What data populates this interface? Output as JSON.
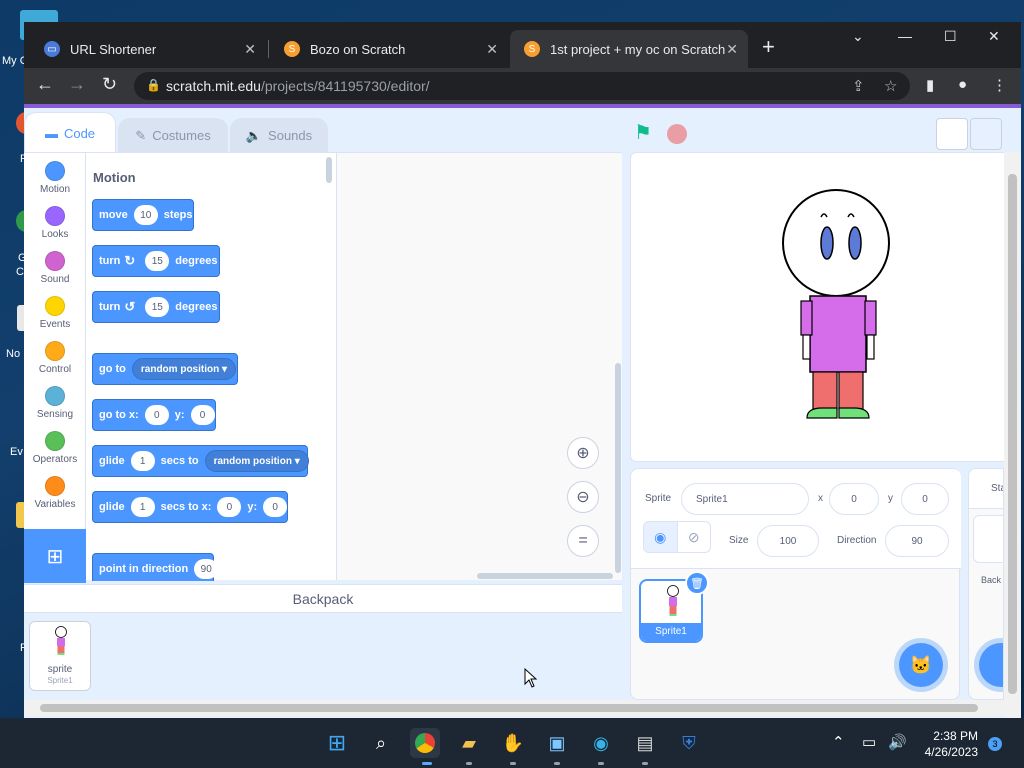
{
  "desktop": {
    "labels": [
      "My C",
      "P",
      "G",
      "C",
      "No",
      "Ev",
      "F"
    ]
  },
  "browser": {
    "tabs": [
      {
        "title": "URL Shortener",
        "icon": "url-shortener-favicon"
      },
      {
        "title": "Bozo on Scratch",
        "icon": "scratch-favicon"
      },
      {
        "title": "1st project + my oc on Scratch",
        "icon": "scratch-favicon"
      }
    ],
    "url_host": "scratch.mit.edu",
    "url_path": "/projects/841195730/editor/"
  },
  "editor": {
    "tabs": {
      "code": "Code",
      "costumes": "Costumes",
      "sounds": "Sounds"
    },
    "categories": [
      {
        "label": "Motion",
        "color": "#4c97ff"
      },
      {
        "label": "Looks",
        "color": "#9966ff"
      },
      {
        "label": "Sound",
        "color": "#cf63cf"
      },
      {
        "label": "Events",
        "color": "#ffd500"
      },
      {
        "label": "Control",
        "color": "#ffab19"
      },
      {
        "label": "Sensing",
        "color": "#5cb1d6"
      },
      {
        "label": "Operators",
        "color": "#59c059"
      },
      {
        "label": "Variables",
        "color": "#ff8c1a"
      }
    ],
    "palette_title": "Motion",
    "blocks": {
      "move": {
        "a": "move",
        "v": "10",
        "b": "steps"
      },
      "turn_right": {
        "a": "turn",
        "v": "15",
        "b": "degrees"
      },
      "turn_left": {
        "a": "turn",
        "v": "15",
        "b": "degrees"
      },
      "goto": {
        "a": "go to",
        "dd": "random position"
      },
      "gotoxy": {
        "a": "go to x:",
        "x": "0",
        "b": "y:",
        "y": "0"
      },
      "glide_to": {
        "a": "glide",
        "v": "1",
        "b": "secs to",
        "dd": "random position"
      },
      "glide_xy": {
        "a": "glide",
        "v": "1",
        "b": "secs to x:",
        "x": "0",
        "c": "y:",
        "y": "0"
      },
      "point": {
        "a": "point in direction",
        "v": "90"
      }
    },
    "backpack": {
      "title": "Backpack",
      "item_name": "sprite",
      "item_sub": "Sprite1"
    }
  },
  "sprite_info": {
    "sprite_label": "Sprite",
    "sprite_name": "Sprite1",
    "x_label": "x",
    "x": "0",
    "y_label": "y",
    "y": "0",
    "size_label": "Size",
    "size": "100",
    "direction_label": "Direction",
    "direction": "90",
    "thumb_name": "Sprite1"
  },
  "stage_pane": {
    "header": "Sta",
    "backdrops": "Back"
  },
  "taskbar": {
    "time": "2:38 PM",
    "date": "4/26/2023",
    "notifications": "3"
  }
}
